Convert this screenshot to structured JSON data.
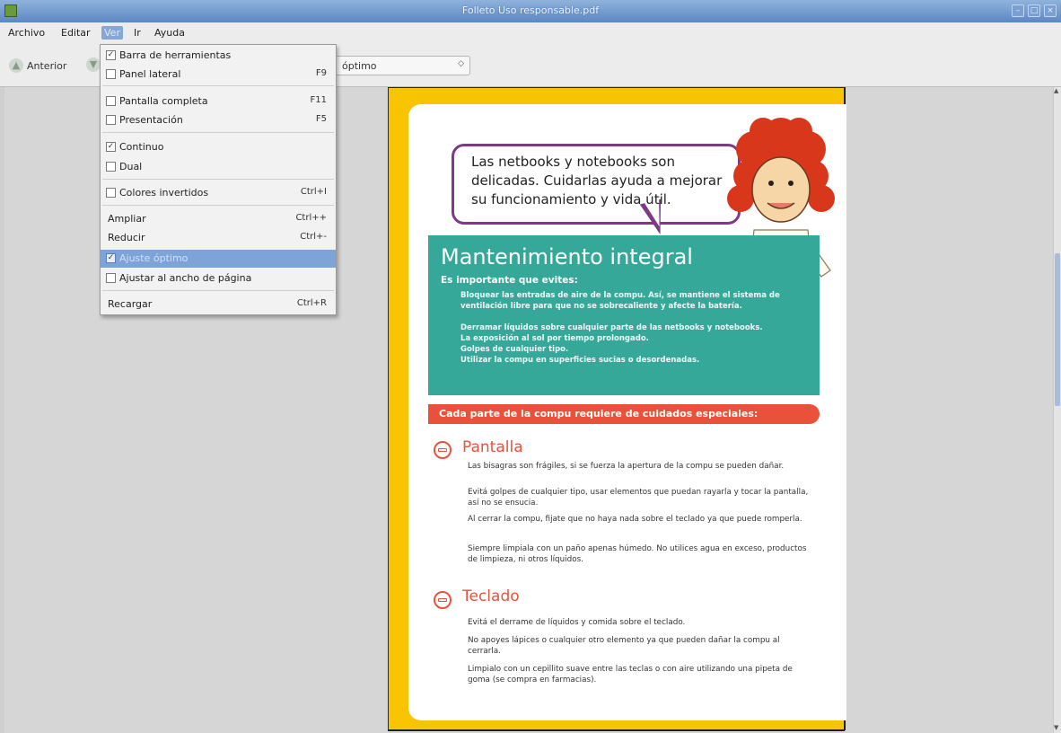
{
  "window": {
    "title": "Folleto Uso responsable.pdf"
  },
  "menubar": {
    "archivo": "Archivo",
    "editar": "Editar",
    "ver": "Ver",
    "ir": "Ir",
    "ayuda": "Ayuda"
  },
  "toolbar": {
    "prev": "Anterior",
    "zoom_value": "Ajuste óptimo",
    "zoom_visible": "óptimo"
  },
  "view_menu": {
    "items": [
      {
        "label": "Barra de herramientas",
        "checked": true,
        "shortcut": ""
      },
      {
        "label": "Panel lateral",
        "checked": false,
        "shortcut": "F9"
      },
      {
        "label": "Pantalla completa",
        "checked": false,
        "shortcut": "F11"
      },
      {
        "label": "Presentación",
        "checked": false,
        "shortcut": "F5"
      },
      {
        "label": "Continuo",
        "checked": true,
        "shortcut": ""
      },
      {
        "label": "Dual",
        "checked": false,
        "shortcut": ""
      },
      {
        "label": "Colores invertidos",
        "checked": false,
        "shortcut": "Ctrl+I"
      },
      {
        "label": "Ampliar",
        "shortcut": "Ctrl++"
      },
      {
        "label": "Reducir",
        "shortcut": "Ctrl+-"
      },
      {
        "label": "Ajuste óptimo",
        "checked": true,
        "shortcut": "",
        "highlighted": true
      },
      {
        "label": "Ajustar al ancho de página",
        "checked": false,
        "shortcut": ""
      },
      {
        "label": "Recargar",
        "shortcut": "Ctrl+R"
      }
    ]
  },
  "page": {
    "bubble": "Las netbooks y notebooks son delicadas. Cuidarlas ayuda a mejorar su funcionamiento y vida útil.",
    "maint_title": "Mantenimiento integral",
    "maint_sub": "Es importante que evites:",
    "maint_bullets": [
      "Bloquear las entradas de aire de la compu. Así, se mantiene el sistema de ventilación libre para que no se sobrecaliente y afecte la batería.",
      "Derramar líquidos sobre cualquier parte de las netbooks y notebooks.",
      "La exposición al sol por tiempo prolongado.",
      "Golpes de cualquier tipo.",
      "Utilizar la compu en superficies sucias o desordenadas."
    ],
    "red_bar": "Cada parte de la compu requiere de cuidados especiales:",
    "pantalla_title": "Pantalla",
    "pantalla_paras": [
      "Las bisagras son frágiles, si se fuerza la apertura de la compu se pueden dañar.",
      "Evitá golpes de cualquier tipo, usar elementos que puedan rayarla y tocar la pantalla, así no se ensucia.",
      "Al cerrar la compu, fijate que no haya nada sobre el teclado ya que puede romperla.",
      "Siempre limpiala con un paño apenas húmedo. No utilices agua en exceso, productos de limpieza, ni otros líquidos."
    ],
    "teclado_title": "Teclado",
    "teclado_paras": [
      "Evitá el derrame de líquidos y comida sobre el teclado.",
      "No apoyes lápices o cualquier otro elemento ya que pueden dañar la compu al cerrarla.",
      "Limpialo con un cepillito suave entre las teclas o con aire utilizando una pipeta de goma (se compra en farmacias)."
    ]
  }
}
